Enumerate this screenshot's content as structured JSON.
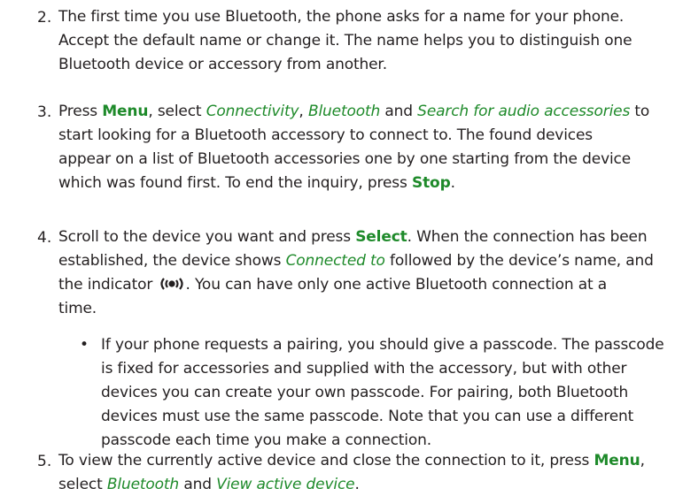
{
  "step2": {
    "number": "2.",
    "lines": [
      "The first time you use Bluetooth, the phone asks for a name for your phone.",
      "Accept the default name or change it. The name helps you to distinguish one",
      "Bluetooth device or accessory from another."
    ]
  },
  "step3": {
    "number": "3.",
    "press": "Press ",
    "menu": "Menu",
    "select": ", select ",
    "connectivity": "Connectivity",
    "comma": ", ",
    "bluetooth": "Bluetooth",
    "and": " and ",
    "search": "Search for audio accessories",
    "to": " to",
    "line2": "start looking for  a Bluetooth  accessory to connect to.  The found devices",
    "line3": "appear on a list of Bluetooth accessories one by one starting from the device",
    "line4_pre": "which was found first. To end the inquiry, press ",
    "stop": "Stop",
    "period": "."
  },
  "step4": {
    "number": "4.",
    "line1_pre": "Scroll to the device you want and press ",
    "select_kw": "Select",
    "line1_post": ". When the connection has been",
    "line2_pre": "established, the device shows ",
    "connected_to": "Connected to",
    "line2_post": " followed by the device’s name, and",
    "line3_pre": "the indicator ",
    "line3_post": ". You can have only one active Bluetooth connection at a",
    "line4": "time.",
    "bullet_symbol": "•",
    "bullet_lines": [
      "If your phone requests a pairing, you should give a passcode. The passcode",
      "is fixed for accessories and supplied with the accessory, but with other",
      "devices you can create your own passcode. For pairing, both Bluetooth",
      "devices must use the same passcode. Note that you can use a different",
      "passcode each time you make a connection."
    ]
  },
  "step5": {
    "number": "5.",
    "line1_pre": "To view the currently active device and close the connection to it, press ",
    "menu": "Menu",
    "line1_post": ",",
    "line2_pre": "select ",
    "bluetooth": "Bluetooth",
    "and": " and ",
    "view_active": "View active device",
    "period": "."
  },
  "icons": {
    "bluetooth_indicator": "bluetooth-connected-icon"
  },
  "colors": {
    "text": "#231f20",
    "accent": "#1e8a2a"
  }
}
